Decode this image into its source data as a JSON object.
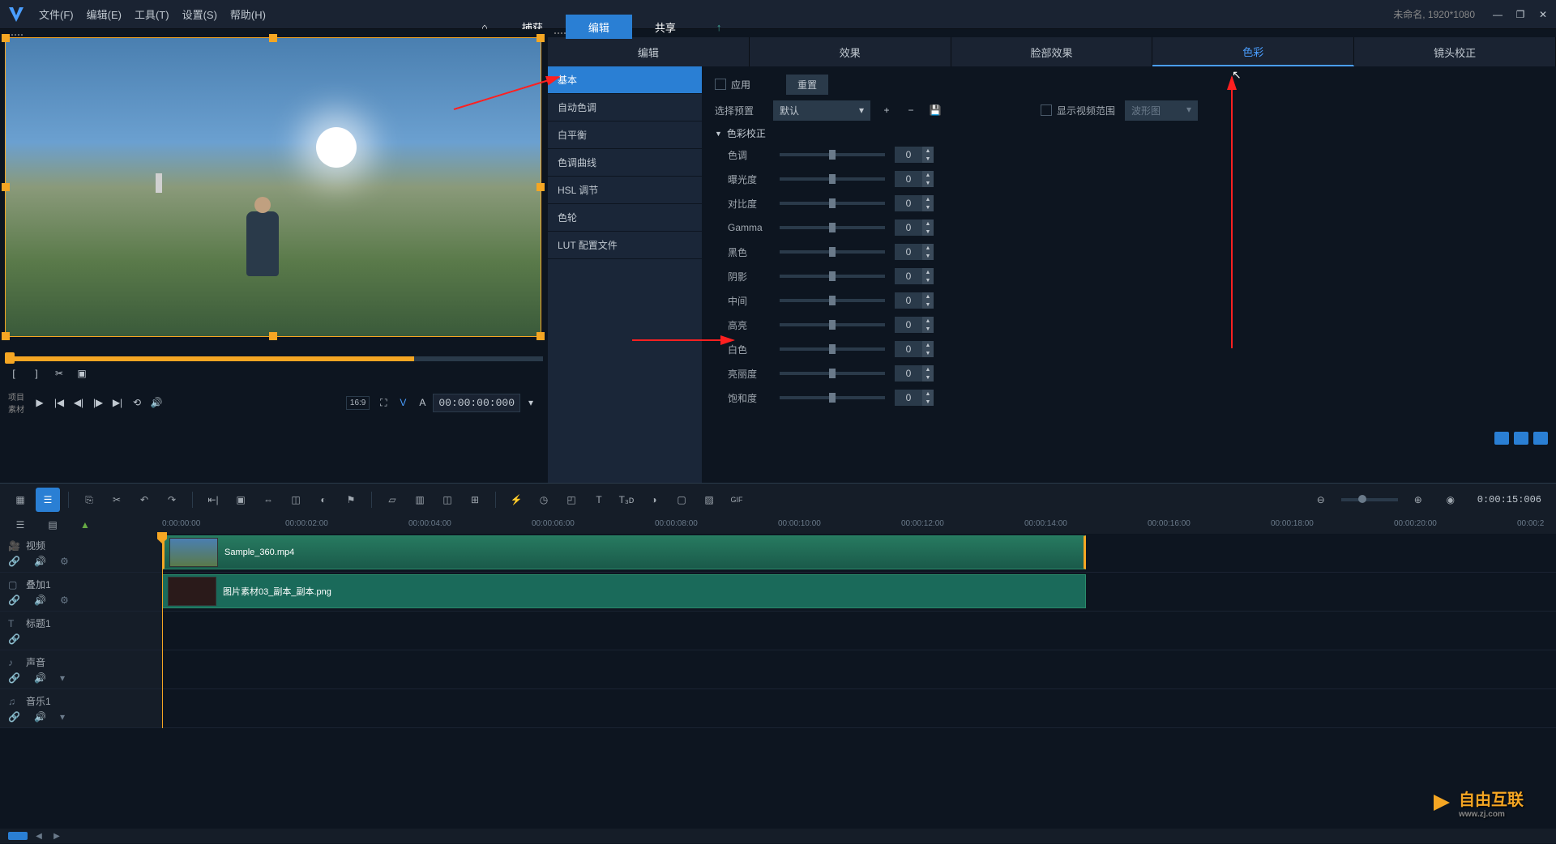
{
  "menu": {
    "items": [
      "文件(F)",
      "编辑(E)",
      "工具(T)",
      "设置(S)",
      "帮助(H)"
    ]
  },
  "project": {
    "name_res": "未命名, 1920*1080"
  },
  "modes": {
    "home": "⌂",
    "capture": "捕获",
    "edit": "编辑",
    "share": "共享"
  },
  "right_tabs": [
    "编辑",
    "效果",
    "脸部效果",
    "色彩",
    "镜头校正"
  ],
  "side_list": [
    "基本",
    "自动色调",
    "白平衡",
    "色调曲线",
    "HSL 调节",
    "色轮",
    "LUT 配置文件"
  ],
  "props": {
    "apply": "应用",
    "reset": "重置",
    "choose_preset": "选择预置",
    "default": "默认",
    "show_range": "显示视频范围",
    "wave": "波形图",
    "section": "色彩校正",
    "sliders": [
      {
        "label": "色调",
        "value": "0"
      },
      {
        "label": "曝光度",
        "value": "0"
      },
      {
        "label": "对比度",
        "value": "0"
      },
      {
        "label": "Gamma",
        "value": "0"
      },
      {
        "label": "黑色",
        "value": "0"
      },
      {
        "label": "阴影",
        "value": "0"
      },
      {
        "label": "中间",
        "value": "0"
      },
      {
        "label": "高亮",
        "value": "0"
      },
      {
        "label": "白色",
        "value": "0"
      },
      {
        "label": "亮丽度",
        "value": "0"
      },
      {
        "label": "饱和度",
        "value": "0"
      }
    ]
  },
  "preview": {
    "labels": [
      "项目",
      "素材"
    ],
    "timecode": "00:00:00:000",
    "aspect": "16:9",
    "v_label": "V",
    "a_label": "A"
  },
  "timeline": {
    "current": "0:00:15:006",
    "marks": [
      "0:00:00:00",
      "00:00:02:00",
      "00:00:04:00",
      "00:00:06:00",
      "00:00:08:00",
      "00:00:10:00",
      "00:00:12:00",
      "00:00:14:00",
      "00:00:16:00",
      "00:00:18:00",
      "00:00:20:00",
      "00:00:2"
    ],
    "tracks": [
      {
        "name": "视频",
        "type": "video",
        "clip": "Sample_360.mp4"
      },
      {
        "name": "叠加1",
        "type": "overlay",
        "clip": "图片素材03_副本_副本.png"
      },
      {
        "name": "标题1",
        "type": "title"
      },
      {
        "name": "声音",
        "type": "audio"
      },
      {
        "name": "音乐1",
        "type": "music"
      }
    ]
  },
  "watermark": {
    "text": "自由互联",
    "sub": "www.zj.com"
  }
}
